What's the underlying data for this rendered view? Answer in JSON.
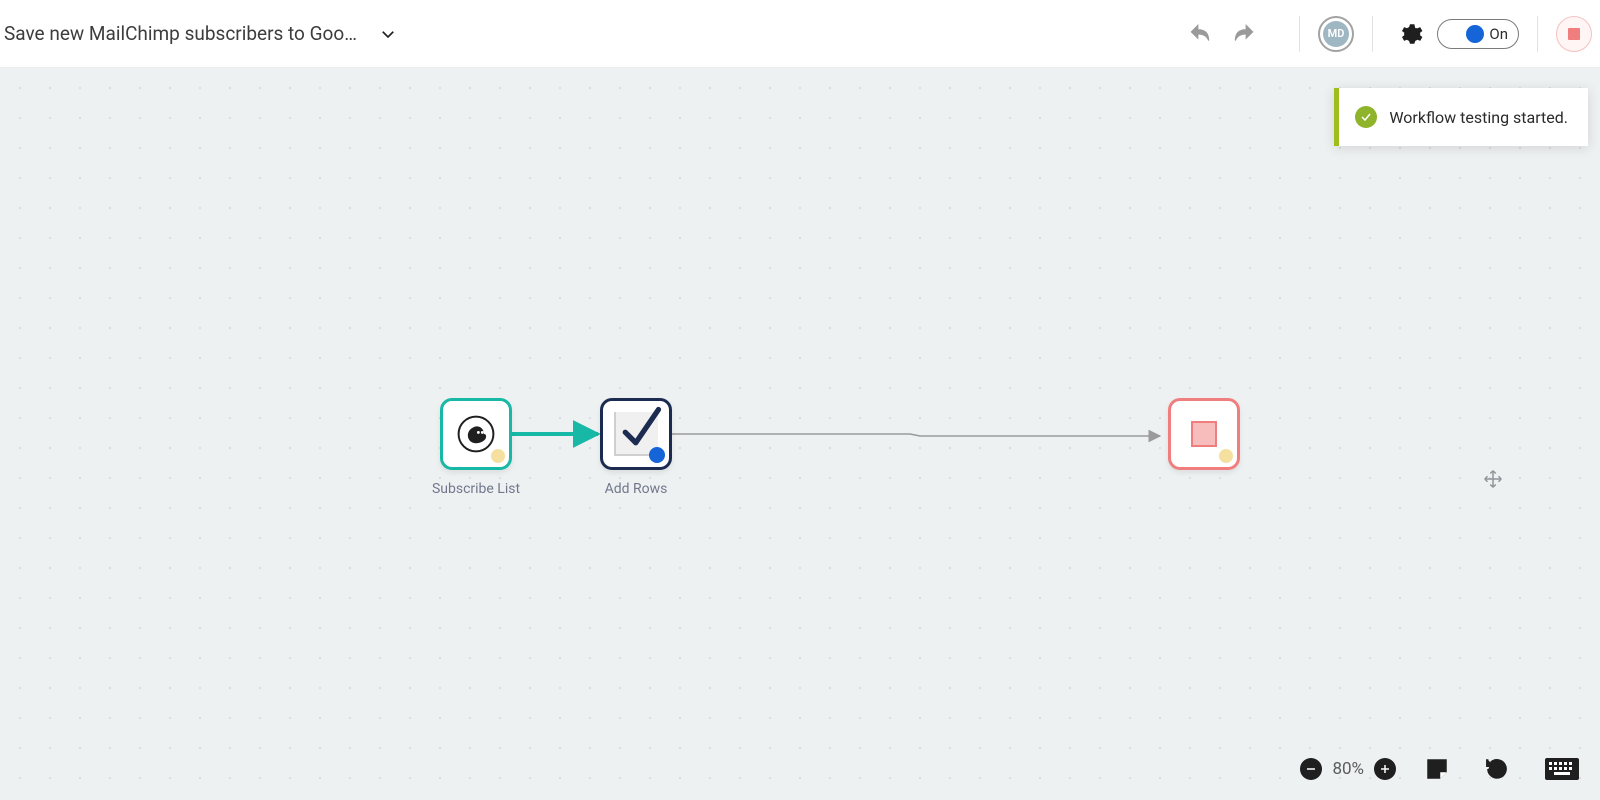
{
  "header": {
    "title": "Save new MailChimp subscribers to Goo…",
    "avatar_initials": "MD",
    "toggle_label": "On"
  },
  "toast": {
    "message": "Workflow testing started."
  },
  "nodes": {
    "subscribe": {
      "label": "Subscribe List"
    },
    "addrows": {
      "label": "Add Rows"
    }
  },
  "footer": {
    "zoom_label": "80%"
  }
}
